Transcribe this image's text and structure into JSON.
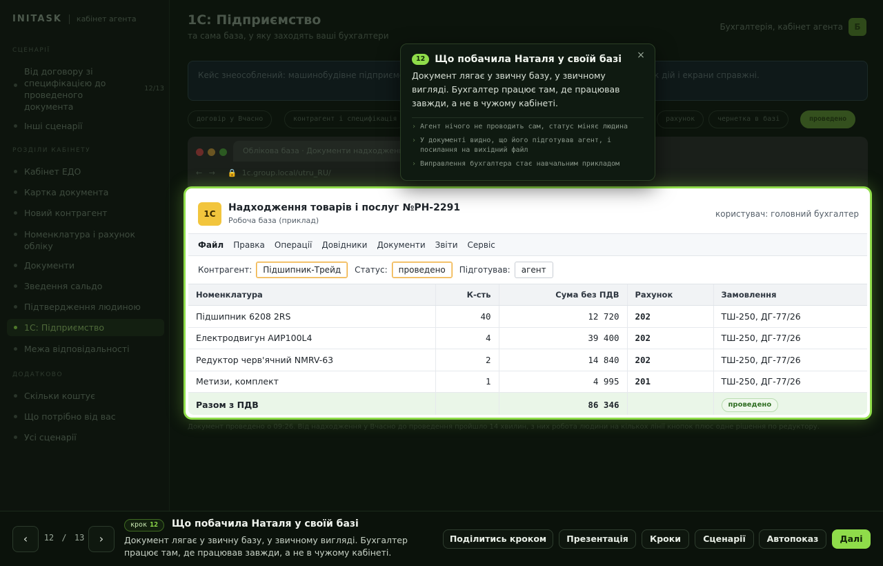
{
  "sidebar": {
    "logo": "INITASK",
    "logo_sub": "кабінет агента",
    "scenarios_label": "СЦЕНАРІЇ",
    "scenarios": [
      {
        "label": "Від договору зі специфікацією до проведеного документа",
        "count": "12/13"
      },
      {
        "label": "Інші сценарії"
      }
    ],
    "section_label": "РОЗДІЛИ КАБІНЕТУ",
    "sections": [
      "Кабінет ЕДО",
      "Картка документа",
      "Новий контрагент",
      "Номенклатура і рахунок обліку",
      "Документи",
      "Зведення сальдо",
      "Підтвердження людиною",
      "1С: Підприємство",
      "Межа відповідальності"
    ],
    "more_label": "ДОДАТКОВО",
    "more": [
      "Скільки коштує",
      "Що потрібно від вас",
      "Усі сценарії"
    ]
  },
  "main": {
    "title": "1С: Підприємство",
    "subtitle": "та сама база, у яку заходять ваші бухгалтери",
    "user": "Бухгалтерія, кабінет агента",
    "avatar": "Б",
    "info": "Кейс знеособлений: машинобудівне підприємство … вигляді, номери документів і суми змінені, порядок дій і екрани справжні.",
    "chips": [
      "договір у Вчасно",
      "контрагент і специфікація",
      "рахунок",
      "чернетка в базі",
      "проведено"
    ],
    "note": "Документ проведено о 09:26. Від надходження у Вчасно до проведення пройшло 14 хвилин, з них робота людини на кількох лінії кнопок плюс одне рішення по редуктору."
  },
  "browser": {
    "tab_title": "Облікова база · Документи надходження",
    "url": "1c.group.local/utru_RU/"
  },
  "document": {
    "logo": "1С",
    "title": "Надходження товарів і послуг №РН-2291",
    "subtitle": "Робоча база (приклад)",
    "user": "користувач: головний бухгалтер",
    "menu": [
      "Файл",
      "Правка",
      "Операції",
      "Довідники",
      "Документи",
      "Звіти",
      "Сервіс"
    ],
    "fields": {
      "counterparty_label": "Контрагент:",
      "counterparty": "Підшипник-Трейд",
      "status_label": "Статус:",
      "status": "проведено",
      "prepared_label": "Підготував:",
      "prepared": "агент"
    },
    "columns": [
      "Номенклатура",
      "К-сть",
      "Сума без ПДВ",
      "Рахунок",
      "Замовлення"
    ],
    "rows": [
      {
        "name": "Підшипник 6208 2RS",
        "qty": "40",
        "sum": "12 720",
        "account": "202",
        "order": "ТШ-250, ДГ-77/26"
      },
      {
        "name": "Електродвигун АИР100L4",
        "qty": "4",
        "sum": "39 400",
        "account": "202",
        "order": "ТШ-250, ДГ-77/26"
      },
      {
        "name": "Редуктор черв'ячний NMRV-63",
        "qty": "2",
        "sum": "14 840",
        "account": "202",
        "order": "ТШ-250, ДГ-77/26"
      },
      {
        "name": "Метизи, комплект",
        "qty": "1",
        "sum": "4 995",
        "account": "201",
        "order": "ТШ-250, ДГ-77/26"
      }
    ],
    "total": {
      "label": "Разом з ПДВ",
      "sum": "86 346",
      "status": "проведено"
    }
  },
  "popover": {
    "badge": "12",
    "title": "Що побачила Наталя у своїй базі",
    "body": "Документ лягає у звичну базу, у звичному вигляді. Бухгалтер працює там, де працював завжди, а не в чужому кабінеті.",
    "close": "×",
    "bullets": [
      "Агент нічого не проводить сам, статус міняє людина",
      "У документі видно, що його підготував агент, і посилання на вихідний файл",
      "Виправлення бухгалтера стає навчальним прикладом"
    ]
  },
  "bottom": {
    "prev": "‹",
    "next": "›",
    "current": "12",
    "sep": "/",
    "total": "13",
    "step_label": "крок",
    "step_num": "12",
    "title": "Що побачила Наталя у своїй базі",
    "desc": "Документ лягає у звичну базу, у звичному вигляді. Бухгалтер працює там, де працював завжди, а не в чужому кабінеті.",
    "buttons": [
      "Поділитись кроком",
      "Презентація",
      "Кроки",
      "Сценарії",
      "Автопоказ",
      "Далі"
    ]
  },
  "colors": {
    "accent": "#8fdc4a",
    "onec_logo": "#f2c53d",
    "field_highlight": "#f0ae3b",
    "total_row": "#eaf6e8"
  }
}
